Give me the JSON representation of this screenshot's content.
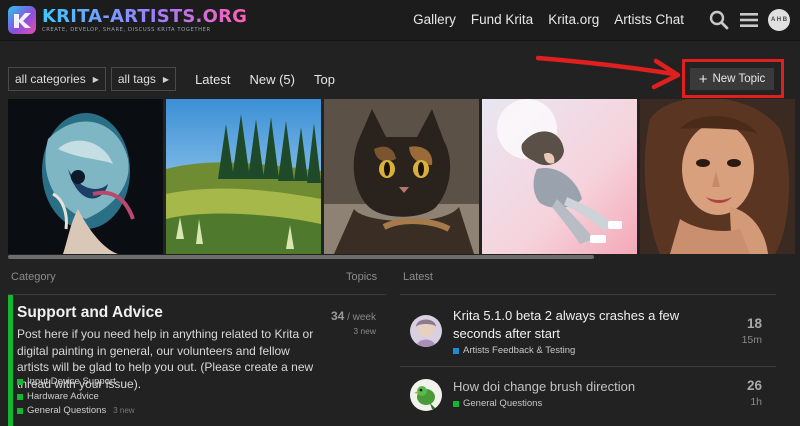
{
  "header": {
    "logo_title": "KRITA-ARTISTS.ORG",
    "logo_tagline": "CREATE, DEVELOP, SHARE, DISCUSS KRITA TOGETHER",
    "nav": [
      "Gallery",
      "Fund Krita",
      "Krita.org",
      "Artists Chat"
    ],
    "avatar_initials": "A H B",
    "icons": [
      "search-icon",
      "hamburger-menu-icon",
      "user-avatar"
    ]
  },
  "filters": {
    "categories_label": "all categories",
    "tags_label": "all tags",
    "latest_label": "Latest",
    "new_label": "New (5)",
    "top_label": "Top",
    "new_topic_label": "New Topic"
  },
  "gallery": {
    "tiles": [
      "abstract-portrait",
      "landscape-trees",
      "tortoiseshell-cat",
      "floating-girl",
      "woman-portrait"
    ]
  },
  "categories": {
    "col_label": "Category",
    "topics_label": "Topics",
    "items": [
      {
        "title": "Support and Advice",
        "color": "#12b832",
        "description": "Post here if you need help in anything related to Krita or digital painting in general, our volunteers and fellow artists will be glad to help you out. (Please create a new thread with your issue).",
        "topics_per": "34",
        "topics_unit": " / week",
        "new_count": "3 new",
        "subcategories": [
          {
            "name": "Input Device Support",
            "new": ""
          },
          {
            "name": "Hardware Advice",
            "new": ""
          },
          {
            "name": "General Questions",
            "new": "3 new"
          }
        ]
      }
    ]
  },
  "latest": {
    "col_label": "Latest",
    "items": [
      {
        "title": "Krita 5.1.0 beta 2 always crashes a few seconds after start",
        "category": "Artists Feedback & Testing",
        "category_color": "#1f8ad6",
        "count": "18",
        "age": "15m"
      },
      {
        "title": "How doi change brush direction",
        "category": "General Questions",
        "category_color": "#12b832",
        "count": "26",
        "age": "1h"
      }
    ]
  }
}
